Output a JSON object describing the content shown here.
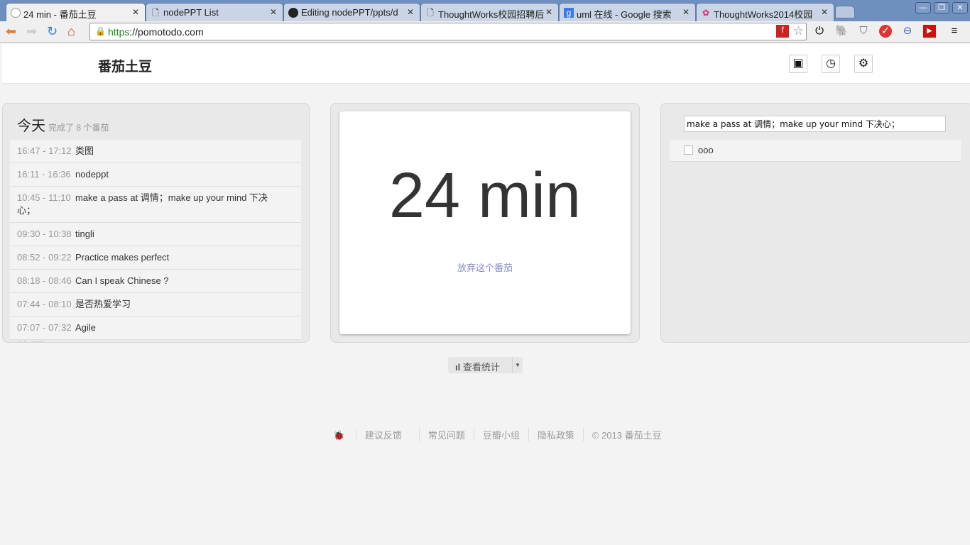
{
  "browser": {
    "tabs": [
      {
        "title": "24 min - 番茄土豆",
        "icon": "pomodoro-icon",
        "active": true
      },
      {
        "title": "nodePPT List",
        "icon": "page-icon"
      },
      {
        "title": "Editing nodePPT/ppts/d",
        "icon": "github-icon"
      },
      {
        "title": "ThoughtWorks校园招聘后",
        "icon": "page-icon"
      },
      {
        "title": "uml 在线 - Google 搜索",
        "icon": "google-icon"
      },
      {
        "title": "ThoughtWorks2014校园",
        "icon": "thoughtworks-icon"
      }
    ],
    "url_scheme": "https",
    "url_rest": "://pomotodo.com"
  },
  "app": {
    "title": "番茄土豆"
  },
  "history": {
    "today_label": "今天",
    "today_summary": "完成了 8 个番茄",
    "items": [
      {
        "time": "16:47 - 17:12",
        "text": "类图"
      },
      {
        "time": "16:11 - 16:36",
        "text": "nodeppt"
      },
      {
        "time": "10:45 - 11:10",
        "text": "make a pass at 调情；make up your mind 下决心；"
      },
      {
        "time": "09:30 - 10:38",
        "text": "tingli"
      },
      {
        "time": "08:52 - 09:22",
        "text": "Practice makes perfect"
      },
      {
        "time": "08:18 - 08:46",
        "text": "Can I speak Chinese ?"
      },
      {
        "time": "07:44 - 08:10",
        "text": "是否热爱学习"
      },
      {
        "time": "07:07 - 07:32",
        "text": "Agile"
      }
    ],
    "yesterday_label": "昨天"
  },
  "timer": {
    "display": "24 min",
    "give_up": "放弃这个番茄"
  },
  "todos": {
    "input_value": "make a pass at 调情；make up your mind 下决心；",
    "items": [
      {
        "text": "ooo",
        "done": false
      }
    ]
  },
  "stats_button": "查看统计",
  "footer": {
    "links": [
      "建议反馈",
      "常见问题",
      "豆瓣小组",
      "隐私政策"
    ],
    "copyright": "© 2013 番茄土豆"
  }
}
